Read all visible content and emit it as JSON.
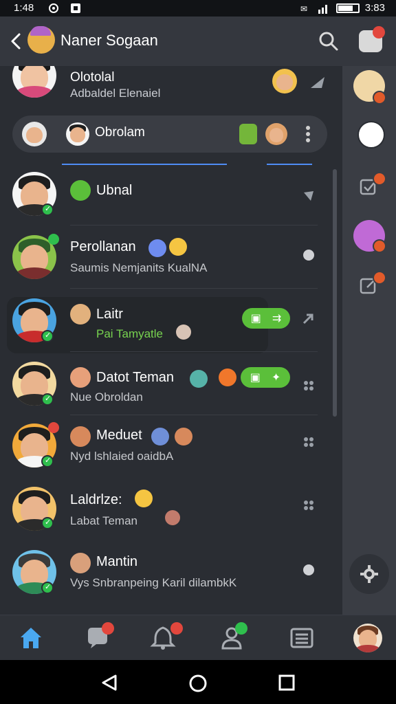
{
  "status_bar": {
    "time_left": "1:48",
    "time_right": "3:83"
  },
  "app_bar": {
    "title": "Naner Sogaan"
  },
  "header_contact": {
    "name": "Olotolal",
    "subtitle": "Adbaldel Elenaiel"
  },
  "chat_pill": {
    "label": "Obrolam"
  },
  "chats": [
    {
      "name": "Ubnal",
      "preview": ""
    },
    {
      "name": "Perollanan",
      "preview": "Saumis Nemjanits KualNA"
    },
    {
      "name": "Laitr",
      "preview": "Pai Tamyatle",
      "preview_color": "#77d24f"
    },
    {
      "name": "Datot Teman",
      "preview": "Nue Obroldan"
    },
    {
      "name": "Meduet",
      "preview": "Nyd lshlaied  oaidbA"
    },
    {
      "name": "Laldrlze:",
      "preview": "Labat Teman"
    },
    {
      "name": "Mantin",
      "preview": "Vys Snbranpeing Karil dilambkK"
    }
  ],
  "colors": {
    "background": "#2a2d33",
    "accent_blue": "#4f8cf5",
    "online_green": "#2fbf4d",
    "action_green": "#5bbf3a",
    "badge_red": "#e2473d"
  },
  "icons": {
    "back": "chevron-left-icon",
    "search": "search-icon",
    "game": "game-controller-icon",
    "settings": "gear-icon",
    "nav": [
      "home-icon",
      "chat-icon",
      "bell-icon",
      "profile-icon",
      "list-icon",
      "avatar"
    ]
  }
}
